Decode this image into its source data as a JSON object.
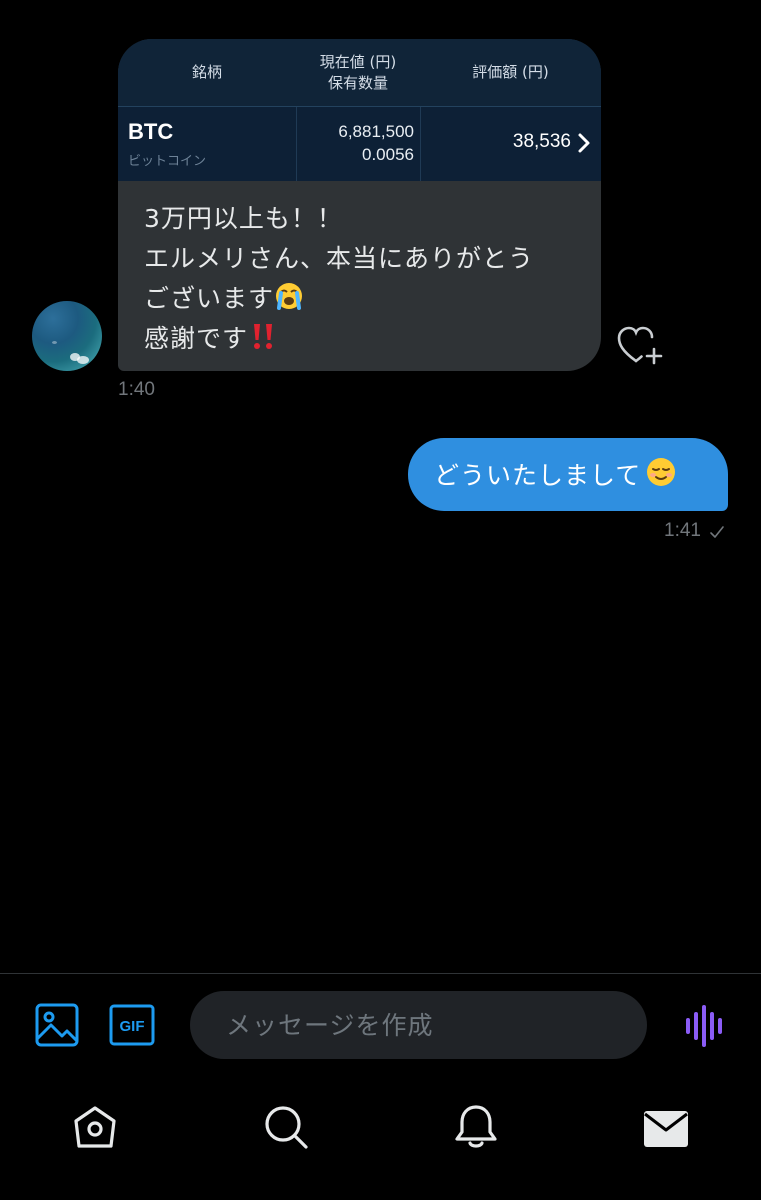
{
  "conversation": {
    "incoming": {
      "stock_card": {
        "col_ticker_header": "銘柄",
        "col_price_header_line1": "現在値 (円)",
        "col_price_header_line2": "保有数量",
        "col_value_header": "評価額 (円)",
        "ticker": "BTC",
        "ticker_name": "ビットコイン",
        "price": "6,881,500",
        "quantity": "0.0056",
        "value": "38,536"
      },
      "text_lines": [
        "3万円以上も！！",
        "エルメリさん、本当にありがとう",
        "ございます",
        "感謝です"
      ],
      "emoji_cry": "loudly-crying-face",
      "emoji_exclaim": "double-exclamation-mark",
      "time": "1:40"
    },
    "outgoing": {
      "text": "どういたしまして",
      "emoji": "smiling-face",
      "time": "1:41"
    }
  },
  "composer": {
    "placeholder": "メッセージを作成",
    "gif_label": "GIF"
  },
  "tabs": [
    "home",
    "search",
    "notifications",
    "messages"
  ],
  "colors": {
    "background": "#000000",
    "incoming_bubble": "#2f3336",
    "outgoing_bubble": "#2f8fe0",
    "accent_blue": "#1d9bf0",
    "voice_purple": "#8b5cf6",
    "stock_card": "#0f2238"
  }
}
